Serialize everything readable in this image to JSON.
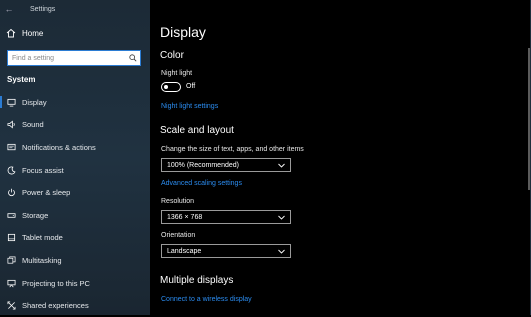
{
  "window": {
    "title": "Settings"
  },
  "sidebar": {
    "home_label": "Home",
    "search_placeholder": "Find a setting",
    "section_label": "System",
    "items": [
      {
        "label": "Display",
        "icon": "monitor-icon"
      },
      {
        "label": "Sound",
        "icon": "speaker-icon"
      },
      {
        "label": "Notifications & actions",
        "icon": "notifications-icon"
      },
      {
        "label": "Focus assist",
        "icon": "moon-icon"
      },
      {
        "label": "Power & sleep",
        "icon": "power-icon"
      },
      {
        "label": "Storage",
        "icon": "storage-icon"
      },
      {
        "label": "Tablet mode",
        "icon": "tablet-icon"
      },
      {
        "label": "Multitasking",
        "icon": "multitasking-icon"
      },
      {
        "label": "Projecting to this PC",
        "icon": "projecting-icon"
      },
      {
        "label": "Shared experiences",
        "icon": "shared-experiences-icon"
      }
    ]
  },
  "main": {
    "title": "Display",
    "color": {
      "heading": "Color",
      "night_light_label": "Night light",
      "night_light_state": "Off",
      "night_light_settings_link": "Night light settings"
    },
    "scale": {
      "heading": "Scale and layout",
      "change_size_label": "Change the size of text, apps, and other items",
      "scale_value": "100% (Recommended)",
      "advanced_link": "Advanced scaling settings",
      "resolution_label": "Resolution",
      "resolution_value": "1366 × 768",
      "orientation_label": "Orientation",
      "orientation_value": "Landscape"
    },
    "multiple": {
      "heading": "Multiple displays",
      "connect_link": "Connect to a wireless display"
    }
  },
  "colors": {
    "accent": "#2b8cf0",
    "sidebar_bg": "#203241",
    "main_bg": "#000000"
  }
}
